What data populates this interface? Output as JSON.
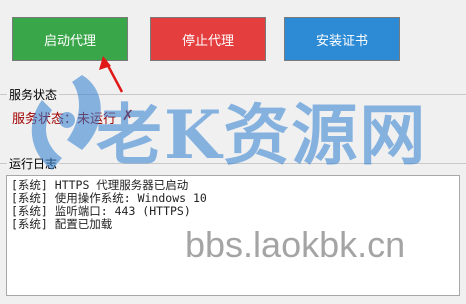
{
  "toolbar": {
    "start_label": "启动代理",
    "stop_label": "停止代理",
    "cert_label": "安装证书"
  },
  "colors": {
    "start": "#3aa64a",
    "stop": "#e53e3e",
    "cert": "#2d8bd6",
    "arrow": "#e01818"
  },
  "status_group": {
    "title": "服务状态",
    "status_text": "服务状态：未运行",
    "close_glyph": "✗"
  },
  "log_group": {
    "title": "运行日志",
    "lines": [
      "[系统] HTTPS 代理服务器已启动",
      "[系统] 使用操作系统: Windows 10",
      "[系统] 监听端口: 443 (HTTPS)",
      "[系统] 配置已加载"
    ]
  },
  "watermark": {
    "brand": "老K资源网",
    "url": "bbs.laokbk.cn",
    "logo_icon": "rocket-logo-icon"
  }
}
